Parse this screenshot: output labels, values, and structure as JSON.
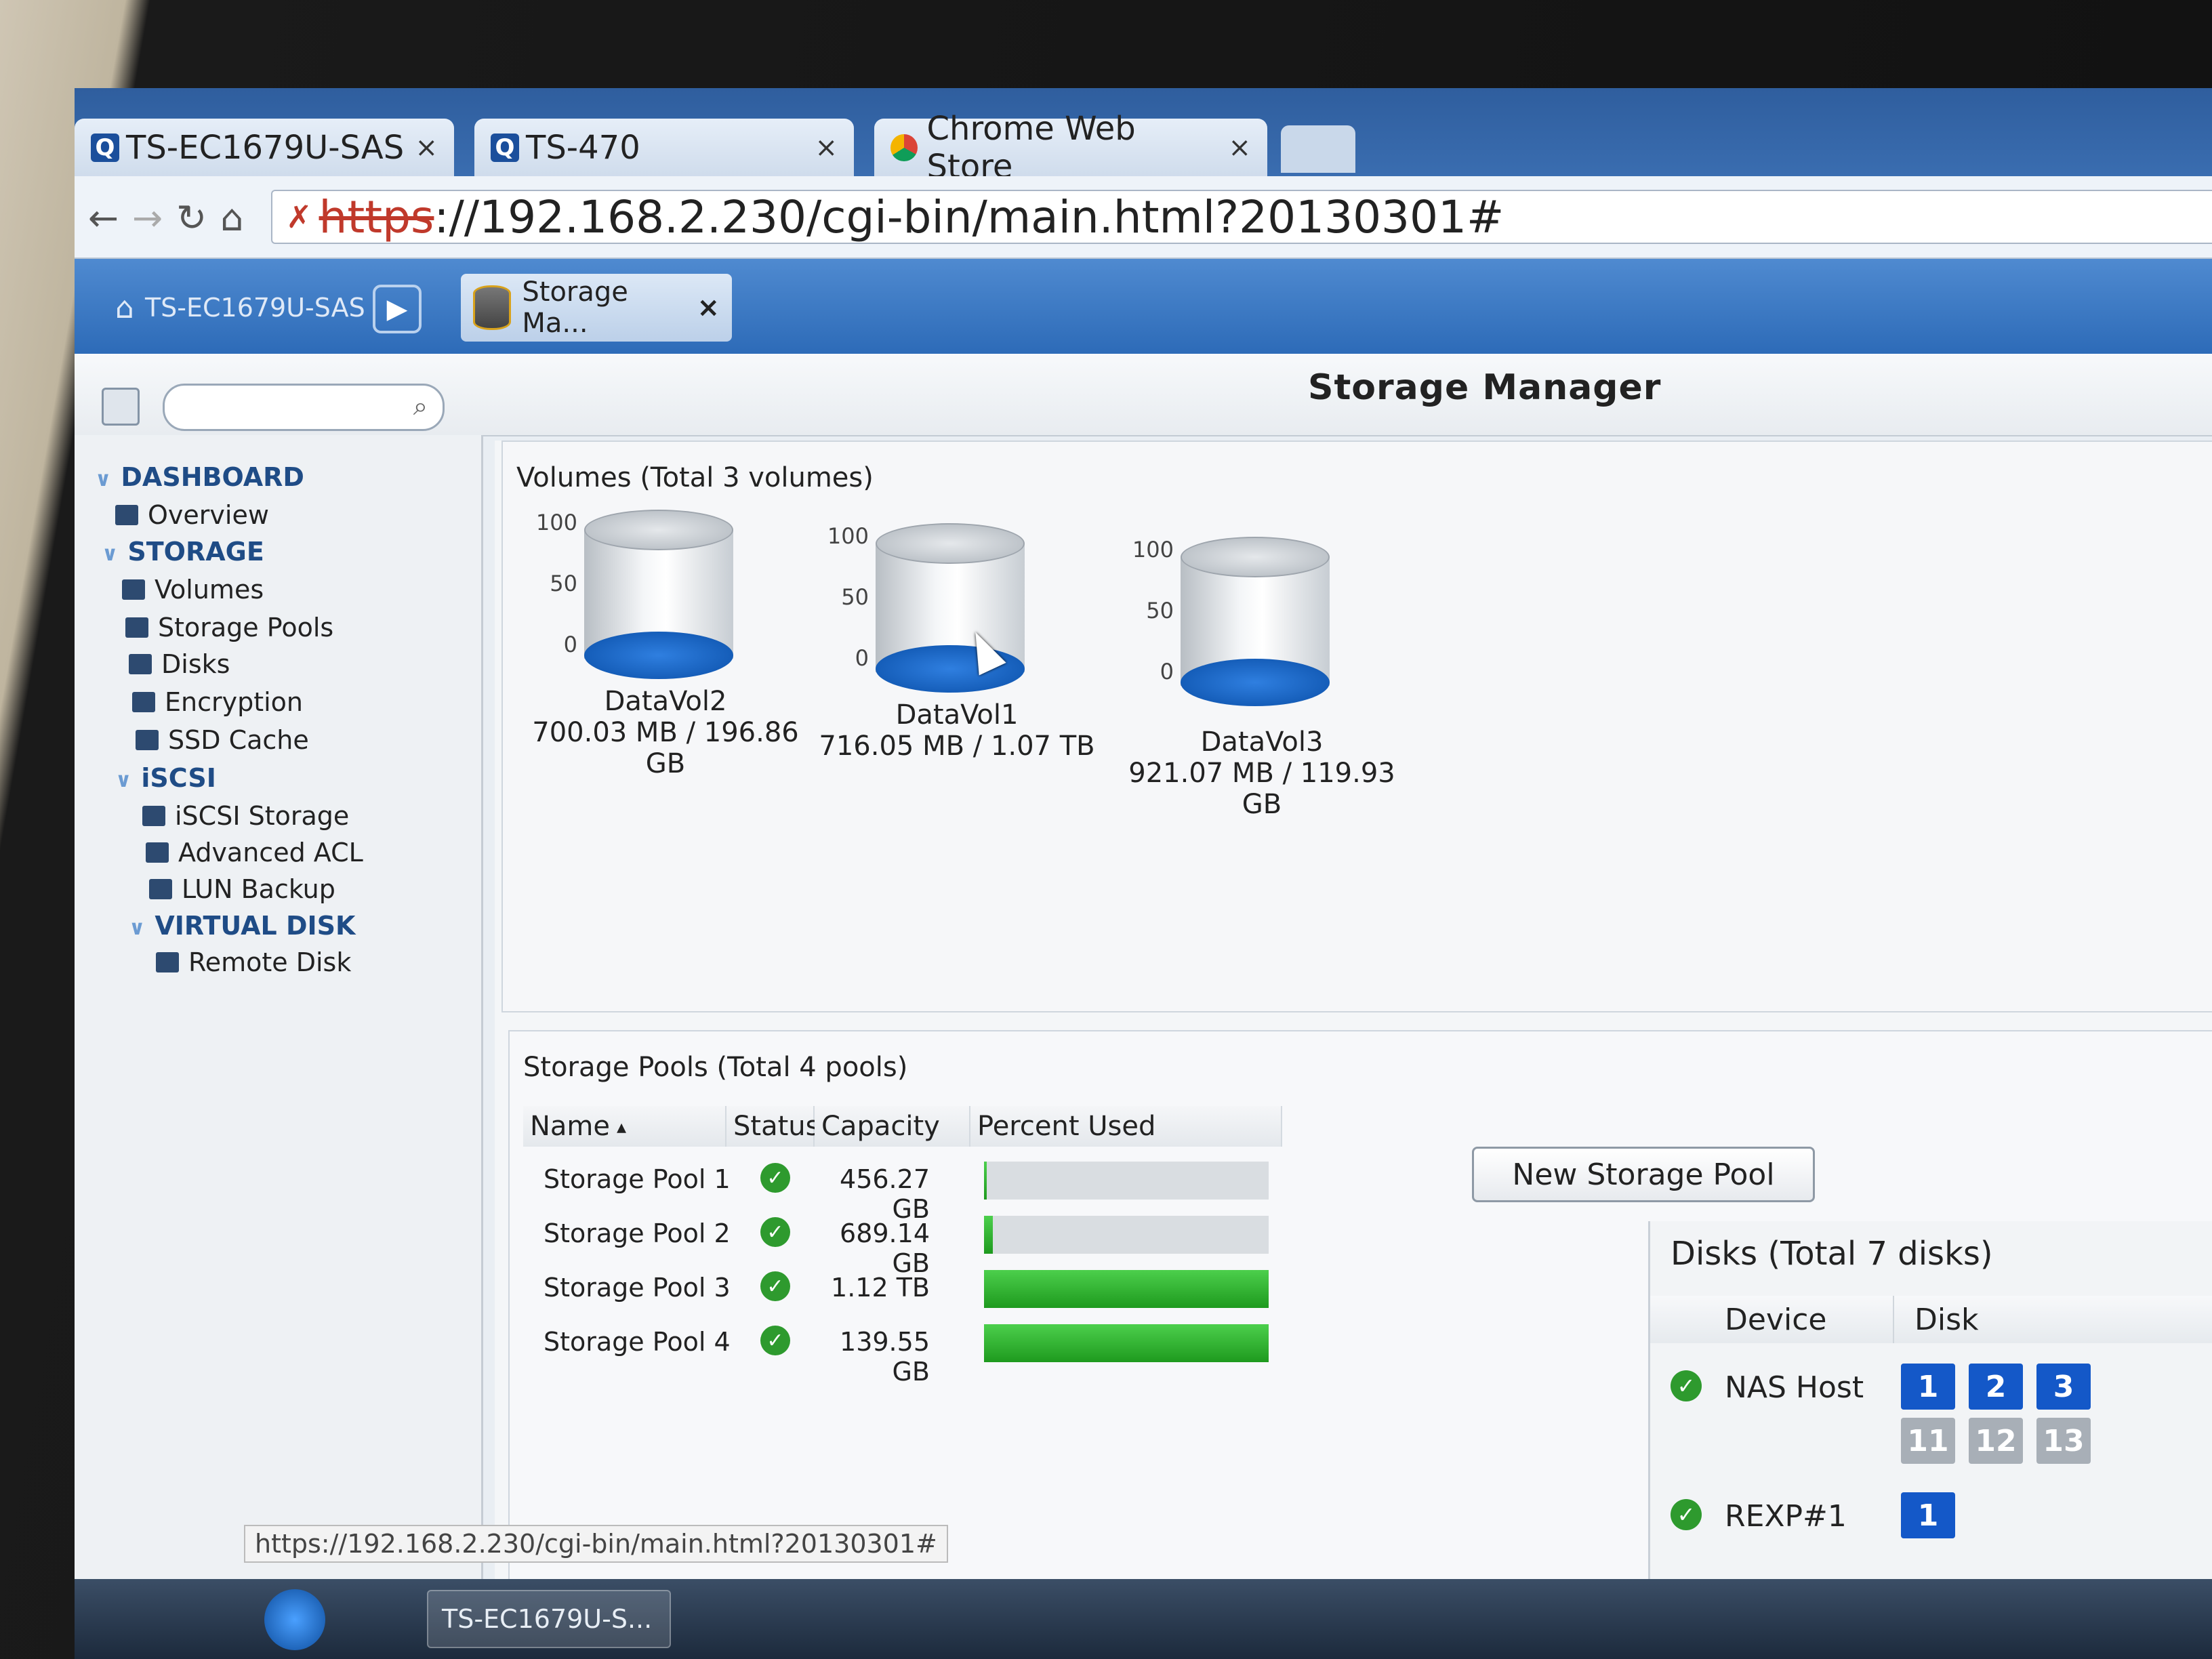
{
  "browser": {
    "tabs": [
      {
        "label": "TS-EC1679U-SAS",
        "close": "×"
      },
      {
        "label": "TS-470",
        "close": "×"
      },
      {
        "label": "Chrome Web Store",
        "close": "×"
      }
    ],
    "url_scheme": "https",
    "url_rest": "://192.168.2.230/cgi-bin/main.html?20130301#",
    "status_url": "https://192.168.2.230/cgi-bin/main.html?20130301#"
  },
  "appbar": {
    "home_label": "TS-EC1679U-SAS",
    "app_tab_label": "Storage Ma...",
    "app_tab_close": "×"
  },
  "window": {
    "title": "Storage Manager",
    "search_placeholder": ""
  },
  "sidebar": {
    "groups": [
      {
        "label": "DASHBOARD",
        "items": [
          "Overview"
        ]
      },
      {
        "label": "STORAGE",
        "items": [
          "Volumes",
          "Storage Pools",
          "Disks",
          "Encryption",
          "SSD Cache"
        ]
      },
      {
        "label": "iSCSI",
        "items": [
          "iSCSI Storage",
          "Advanced ACL",
          "LUN Backup"
        ]
      },
      {
        "label": "VIRTUAL DISK",
        "items": [
          "Remote Disk"
        ]
      }
    ]
  },
  "volumes": {
    "title": "Volumes (Total 3 volumes)",
    "axis_ticks": [
      "100",
      "50",
      "0"
    ],
    "items": [
      {
        "name": "DataVol2",
        "usage_line1": "700.03 MB / 196.86",
        "usage_line2": "GB"
      },
      {
        "name": "DataVol1",
        "usage_line1": "716.05 MB / 1.07 TB",
        "usage_line2": ""
      },
      {
        "name": "DataVol3",
        "usage_line1": "921.07 MB / 119.93",
        "usage_line2": "GB"
      }
    ]
  },
  "pools": {
    "title": "Storage Pools (Total 4 pools)",
    "new_button": "New Storage Pool",
    "columns": [
      "Name",
      "Status",
      "Capacity",
      "Percent Used"
    ],
    "rows": [
      {
        "name": "Storage Pool 1",
        "capacity": "456.27 GB",
        "percent_used": 0.4
      },
      {
        "name": "Storage Pool 2",
        "capacity": "689.14 GB",
        "percent_used": 3
      },
      {
        "name": "Storage Pool 3",
        "capacity": "1.12 TB",
        "percent_used": 100
      },
      {
        "name": "Storage Pool 4",
        "capacity": "139.55 GB",
        "percent_used": 100
      }
    ]
  },
  "disks": {
    "title": "Disks (Total 7 disks)",
    "columns": [
      "Device",
      "Disk"
    ],
    "rows": [
      {
        "device": "NAS Host",
        "slots_top": [
          "1",
          "2",
          "3"
        ],
        "slots_bottom": [
          "11",
          "12",
          "13"
        ]
      },
      {
        "device": "REXP#1",
        "slots_top": [
          "1"
        ],
        "slots_bottom": []
      }
    ]
  },
  "taskbar": {
    "app_label": "TS-EC1679U-S..."
  },
  "colors": {
    "accent": "#2d6bb8",
    "ok": "#2e9a2e",
    "bar_fill": "#1e9a1e",
    "disk_active": "#1458c8"
  }
}
